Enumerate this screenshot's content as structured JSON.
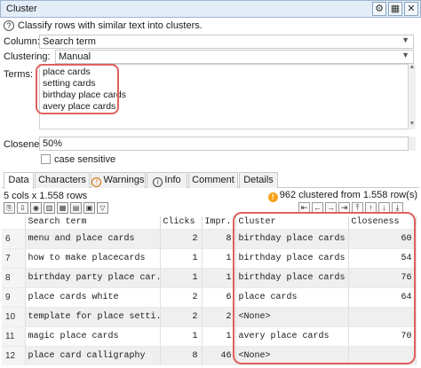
{
  "window": {
    "title": "Cluster",
    "buttons": [
      {
        "name": "settings-icon",
        "glyph": "⚙"
      },
      {
        "name": "table-icon",
        "glyph": "▦"
      },
      {
        "name": "close-icon",
        "glyph": "✕"
      }
    ]
  },
  "help": {
    "icon_glyph": "?",
    "text": "Classify rows with similar text into clusters."
  },
  "column": {
    "label": "Column:",
    "value": "Search term"
  },
  "clustering": {
    "label": "Clustering:",
    "value": "Manual"
  },
  "terms": {
    "label": "Terms:",
    "items": [
      "place cards",
      "setting cards",
      "birthday place cards",
      "avery place cards"
    ]
  },
  "closeness": {
    "label": "Closeness:",
    "value": "50%"
  },
  "case_sensitive": {
    "label": "case sensitive",
    "checked": false
  },
  "tabs": [
    {
      "label": "Data",
      "active": true,
      "icon": ""
    },
    {
      "label": "Characters",
      "active": false,
      "icon": ""
    },
    {
      "label": "Warnings",
      "active": false,
      "icon": "!"
    },
    {
      "label": "Info",
      "active": false,
      "icon": "i"
    },
    {
      "label": "Comment",
      "active": false,
      "icon": ""
    },
    {
      "label": "Details",
      "active": false,
      "icon": ""
    }
  ],
  "status": {
    "rows_info": "5 cols x 1.558 rows",
    "cluster_icon": "!",
    "cluster_text": "962 clustered from 1.558 row(s)"
  },
  "table": {
    "columns": [
      "",
      "Search term",
      "Clicks",
      "Impr.",
      "Cluster",
      "Closeness"
    ],
    "rows": [
      {
        "n": "6",
        "term": "menu and place cards",
        "clicks": "2",
        "impr": "8",
        "cluster": "birthday place cards",
        "closeness": "60"
      },
      {
        "n": "7",
        "term": "how to make placecards",
        "clicks": "1",
        "impr": "1",
        "cluster": "birthday place cards",
        "closeness": "54"
      },
      {
        "n": "8",
        "term": "birthday party place car...",
        "clicks": "1",
        "impr": "1",
        "cluster": "birthday place cards",
        "closeness": "76"
      },
      {
        "n": "9",
        "term": "place cards white",
        "clicks": "2",
        "impr": "6",
        "cluster": "place cards",
        "closeness": "64"
      },
      {
        "n": "10",
        "term": "template for place setti...",
        "clicks": "2",
        "impr": "2",
        "cluster": "<None>",
        "closeness": ""
      },
      {
        "n": "11",
        "term": "magic place cards",
        "clicks": "1",
        "impr": "1",
        "cluster": "avery place cards",
        "closeness": "70"
      },
      {
        "n": "12",
        "term": "place card calligraphy",
        "clicks": "8",
        "impr": "46",
        "cluster": "<None>",
        "closeness": ""
      }
    ]
  },
  "colors": {
    "highlight": "#e06060",
    "titlebar": "#e3edf8",
    "warning": "#f5a21a"
  }
}
